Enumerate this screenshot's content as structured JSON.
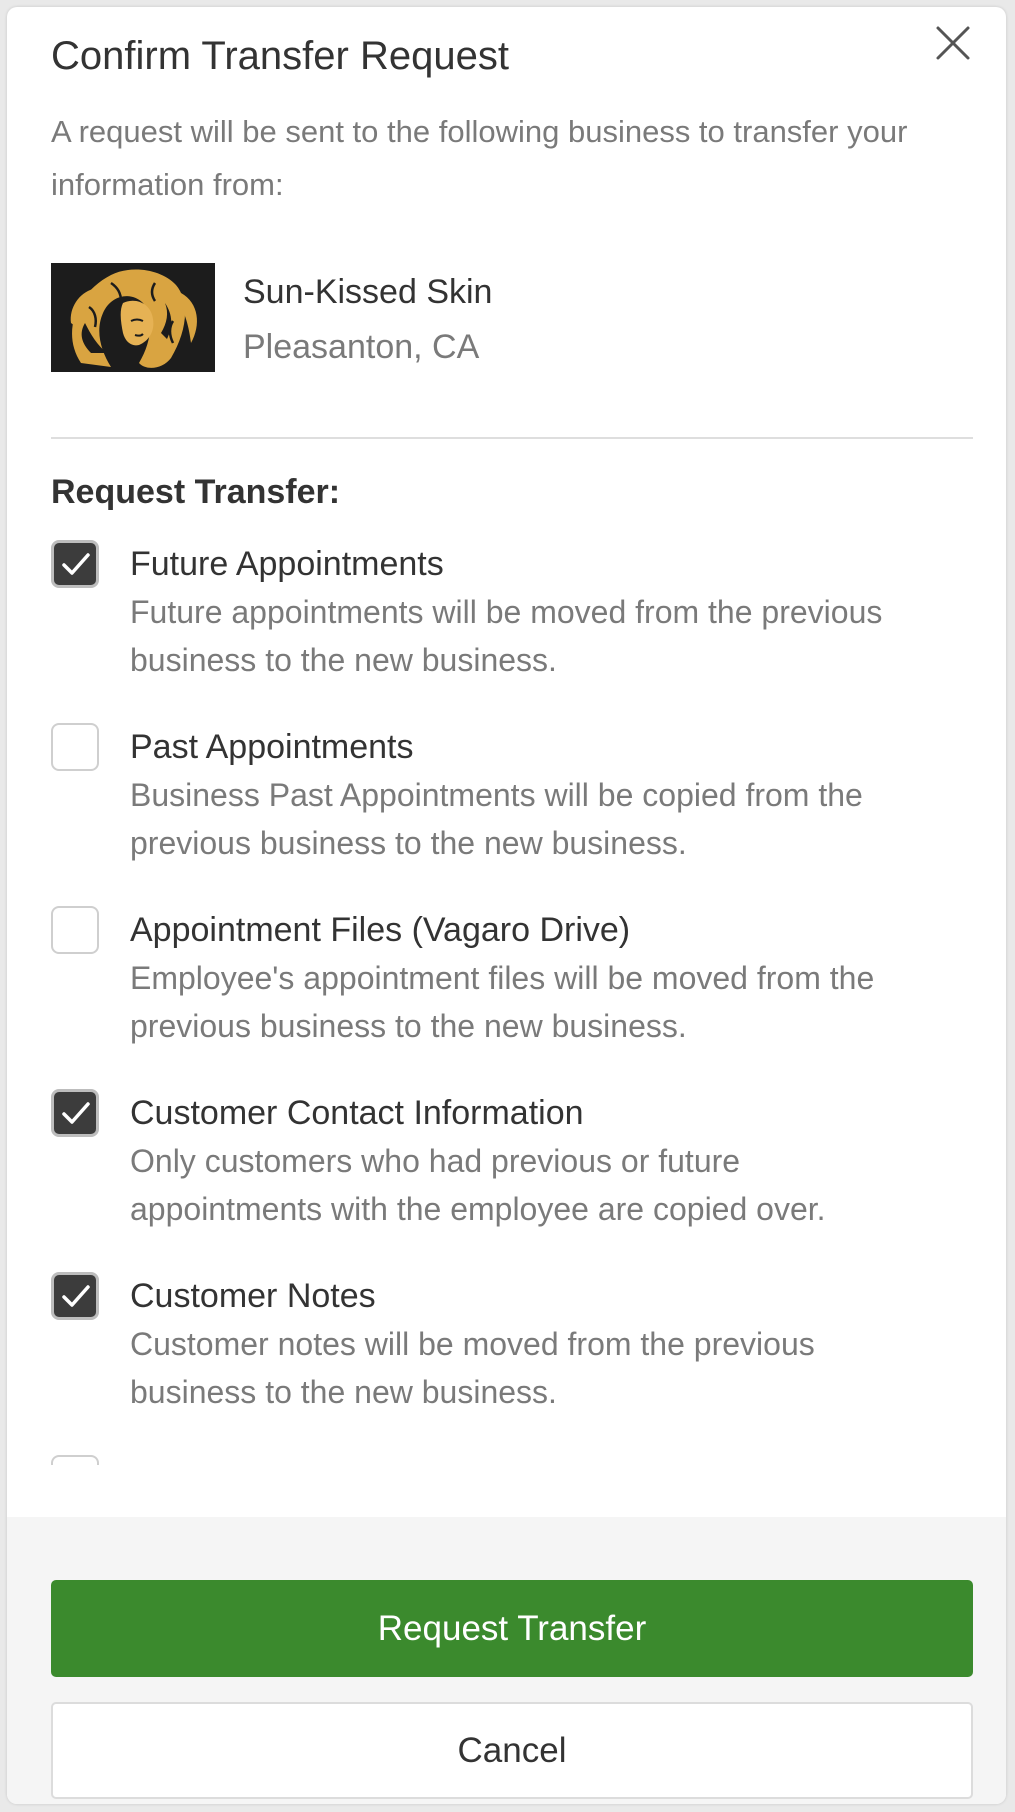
{
  "dialog": {
    "title": "Confirm Transfer Request",
    "intro": "A request will be sent to the following business to transfer your information from:",
    "close_icon": "close-icon"
  },
  "business": {
    "name": "Sun-Kissed Skin",
    "location": "Pleasanton, CA",
    "logo_icon": "woman-silhouette-logo"
  },
  "section_label": "Request Transfer:",
  "options": [
    {
      "title": "Future Appointments",
      "description": "Future appointments will be moved from the previous business to the new business.",
      "checked": true
    },
    {
      "title": "Past Appointments",
      "description": "Business Past Appointments will be copied from the previous business to the new business.",
      "checked": false
    },
    {
      "title": "Appointment Files (Vagaro Drive)",
      "description": "Employee's appointment files will be moved from the previous business to the new business.",
      "checked": false
    },
    {
      "title": "Customer Contact Information",
      "description": "Only customers who had previous or future appointments with the employee are copied over.",
      "checked": true
    },
    {
      "title": "Customer Notes",
      "description": "Customer notes will be moved from the previous business to the new business.",
      "checked": true
    }
  ],
  "buttons": {
    "primary_label": "Request Transfer",
    "secondary_label": "Cancel"
  },
  "colors": {
    "primary_button": "#3b8a2d",
    "checkbox_checked": "#3c3c3c",
    "logo_gold": "#d9a441"
  }
}
